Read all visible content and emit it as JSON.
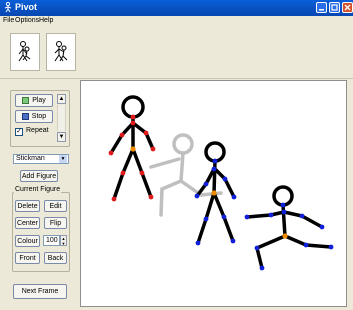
{
  "window": {
    "title": "Pivot"
  },
  "menu": {
    "items": [
      "File",
      "Options",
      "Help"
    ]
  },
  "controls": {
    "play_label": "Play",
    "stop_label": "Stop",
    "repeat_label": "Repeat",
    "repeat_checked": "✓",
    "figure_type": "Stickman",
    "add_figure_label": "Add Figure",
    "current_figure_label": "Current Figure",
    "delete_label": "Delete",
    "edit_label": "Edit",
    "center_label": "Center",
    "flip_label": "Flip",
    "colour_label": "Colour",
    "colour_value": "100",
    "front_label": "Front",
    "back_label": "Back",
    "next_frame_label": "Next Frame"
  },
  "colors": {
    "figure_line": "#000000",
    "joint_red": "#e01b1b",
    "joint_blue": "#1020d8",
    "joint_orange": "#f08a00",
    "ghost": "#bfbfbf"
  }
}
